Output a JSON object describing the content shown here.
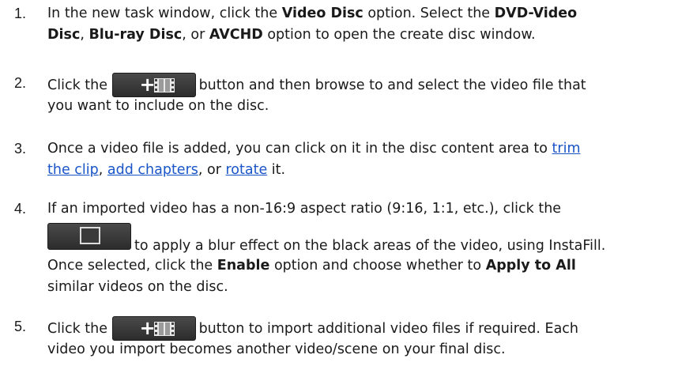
{
  "steps": [
    {
      "number": "1.",
      "line1": {
        "t1": "In the new task window, click the ",
        "b1": "Video Disc",
        "t2": " option. Select the ",
        "b2": "DVD-Video"
      },
      "line2": {
        "b1": "Disc",
        "t1": ", ",
        "b2": "Blu-ray Disc",
        "t2": ", or ",
        "b3": "AVCHD",
        "t3": " option to open the create disc window."
      }
    },
    {
      "number": "2.",
      "line1": {
        "t1": "Click the",
        "t2": "button and then browse to and select the video file that"
      },
      "line2": {
        "t1": "you want to include on the disc."
      },
      "button_icon": "add-media-icon"
    },
    {
      "number": "3.",
      "line1": {
        "t1": "Once a video file is added, you can click on it in the disc content area to ",
        "link1": "trim"
      },
      "line2": {
        "link1": "the clip",
        "t1": ", ",
        "link2": "add chapters",
        "t2": ", or ",
        "link3": "rotate",
        "t3": " it."
      }
    },
    {
      "number": "4.",
      "line1": {
        "t1": "If an imported video has a non-16:9 aspect ratio (9:16, 1:1, etc.), click the"
      },
      "line2": {
        "t1": "to apply a blur effect on the black areas of the video, using InstaFill."
      },
      "line3": {
        "t1": "Once selected, click the ",
        "b1": "Enable",
        "t2": " option and choose whether to ",
        "b2": "Apply to All"
      },
      "line4": {
        "t1": "similar videos on the disc."
      },
      "button_icon": "instafill-frame-icon"
    },
    {
      "number": "5.",
      "line1": {
        "t1": "Click the",
        "t2": "button to import additional video files if required. Each"
      },
      "line2": {
        "t1": "video you import becomes another video/scene on your final disc."
      },
      "button_icon": "add-media-icon"
    }
  ],
  "colors": {
    "text": "#1a1a1a",
    "link": "#1a55c8",
    "button_bg": "#3a3a3a"
  }
}
